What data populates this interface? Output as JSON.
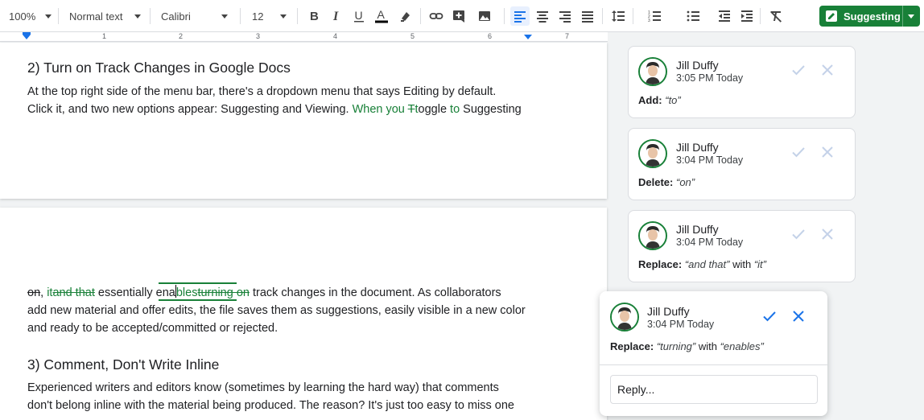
{
  "toolbar": {
    "zoom": "100%",
    "style": "Normal text",
    "font": "Calibri",
    "size": "12",
    "mode_label": "Suggesting",
    "colors": {
      "mode_green": "#188038",
      "text_color_underline": "#000000"
    },
    "icons": [
      "bold-icon",
      "italic-icon",
      "underline-icon",
      "text-color-icon",
      "highlight-icon",
      "link-icon",
      "add-comment-icon",
      "image-icon",
      "align-left-icon",
      "align-center-icon",
      "align-right-icon",
      "justify-icon",
      "line-spacing-icon",
      "numbered-list-icon",
      "bulleted-list-icon",
      "decrease-indent-icon",
      "increase-indent-icon",
      "clear-formatting-icon",
      "pencil-icon"
    ]
  },
  "ruler": {
    "numbers": [
      "1",
      "2",
      "3",
      "4",
      "5",
      "6",
      "7"
    ]
  },
  "document": {
    "heading1": "2) Turn on Track Changes in Google Docs",
    "p1_line1": "At the top right side of the menu bar, there's a dropdown menu that says Editing by default.",
    "p1_line2_prefix": "Click it, and two new options appear: Suggesting and Viewing. ",
    "p1_ins_when_you": "When you ",
    "p1_del_T": "T",
    "p1_text_t": "t",
    "p1_text_oggle": "oggle ",
    "p1_ins_to": "to",
    "p1_text_suggesting": " Suggesting",
    "p1_del_trailing": " ",
    "p2_del_on": "on",
    "p2_text_comma": ", ",
    "p2_ins_it": "it",
    "p2_del_and_that": "and that",
    "p2_text_essentially": " essentially ",
    "p2_ins_ena": "ena",
    "p2_ins_bles": "bles",
    "p2_del_turning_on": "turning on",
    "p2_text_rest": " track changes in the document. As collaborators",
    "p2_line2": "add new material and offer edits, the file saves them as suggestions, easily visible in a new color",
    "p2_line3": "and ready to be accepted/committed or rejected.",
    "heading2": "3) Comment, Don't Write Inline",
    "p3_line1": "Experienced writers and editors know (sometimes by learning the hard way) that comments",
    "p3_line2": "don't belong inline with the material being produced. The reason? It's just too easy to miss one"
  },
  "comments": [
    {
      "author": "Jill Duffy",
      "time": "3:05 PM Today",
      "action": "Add:",
      "body_parts": [
        "“to”"
      ]
    },
    {
      "author": "Jill Duffy",
      "time": "3:04 PM Today",
      "action": "Delete:",
      "body_parts": [
        "“on”"
      ]
    },
    {
      "author": "Jill Duffy",
      "time": "3:04 PM Today",
      "action": "Replace:",
      "body_parts": [
        "“and that”",
        " with ",
        "“it”"
      ]
    },
    {
      "author": "Jill Duffy",
      "time": "3:04 PM Today",
      "action": "Replace:",
      "body_parts": [
        "“turning”",
        " with ",
        "“enables”"
      ],
      "reply_placeholder": "Reply..."
    }
  ]
}
